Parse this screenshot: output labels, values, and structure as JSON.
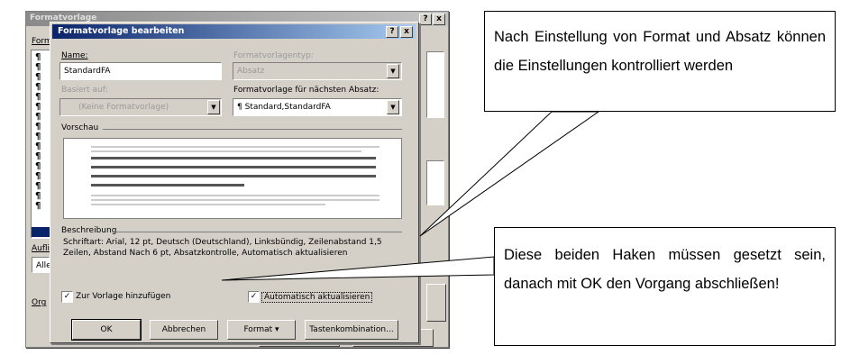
{
  "background_dialog": {
    "title": "Formatvorlage",
    "help_button": "?",
    "close_button": "x",
    "tab_label": "Form",
    "apply_label": "Auflis",
    "apply_value": "Alle",
    "organize_label": "Org",
    "bottom_btn_1": "",
    "bottom_btn_2": "",
    "paragraph_marks": [
      "¶",
      "¶",
      "¶",
      "¶",
      "¶",
      "¶",
      "¶",
      "¶",
      "¶",
      "¶",
      "¶",
      "¶",
      "¶",
      "¶",
      "¶",
      "¶"
    ]
  },
  "dialog": {
    "title": "Formatvorlage bearbeiten",
    "help_button": "?",
    "close_button": "x",
    "name_label": "Name:",
    "name_value": "StandardFA",
    "type_label": "Formatvorlagentyp:",
    "type_value": "Absatz",
    "based_on_label": "Basiert auf:",
    "based_on_value": "(Keine Formatvorlage)",
    "next_label": "Formatvorlage für nächsten Absatz:",
    "next_value": "¶ Standard,StandardFA",
    "preview_label": "Vorschau",
    "description_label": "Beschreibung",
    "description_text": "Schriftart: Arial, 12 pt, Deutsch (Deutschland), Linksbündig, Zeilenabstand 1,5 Zeilen, Abstand Nach 6 pt, Absatzkontrolle, Automatisch aktualisieren",
    "checkbox_add_label": "Zur Vorlage hinzufügen",
    "checkbox_add_checked": true,
    "checkbox_auto_label": "Automatisch aktualisieren",
    "checkbox_auto_checked": true,
    "btn_ok": "OK",
    "btn_cancel": "Abbrechen",
    "btn_format": "Format ▾",
    "btn_shortcut": "Tastenkombination..."
  },
  "callouts": {
    "top_text": "Nach Einstellung von Format und Absatz können die Einstellungen kontrolliert werden",
    "bottom_text": "Diese beiden Haken müssen gesetzt sein, danach mit OK den Vorgang abschließen!"
  }
}
